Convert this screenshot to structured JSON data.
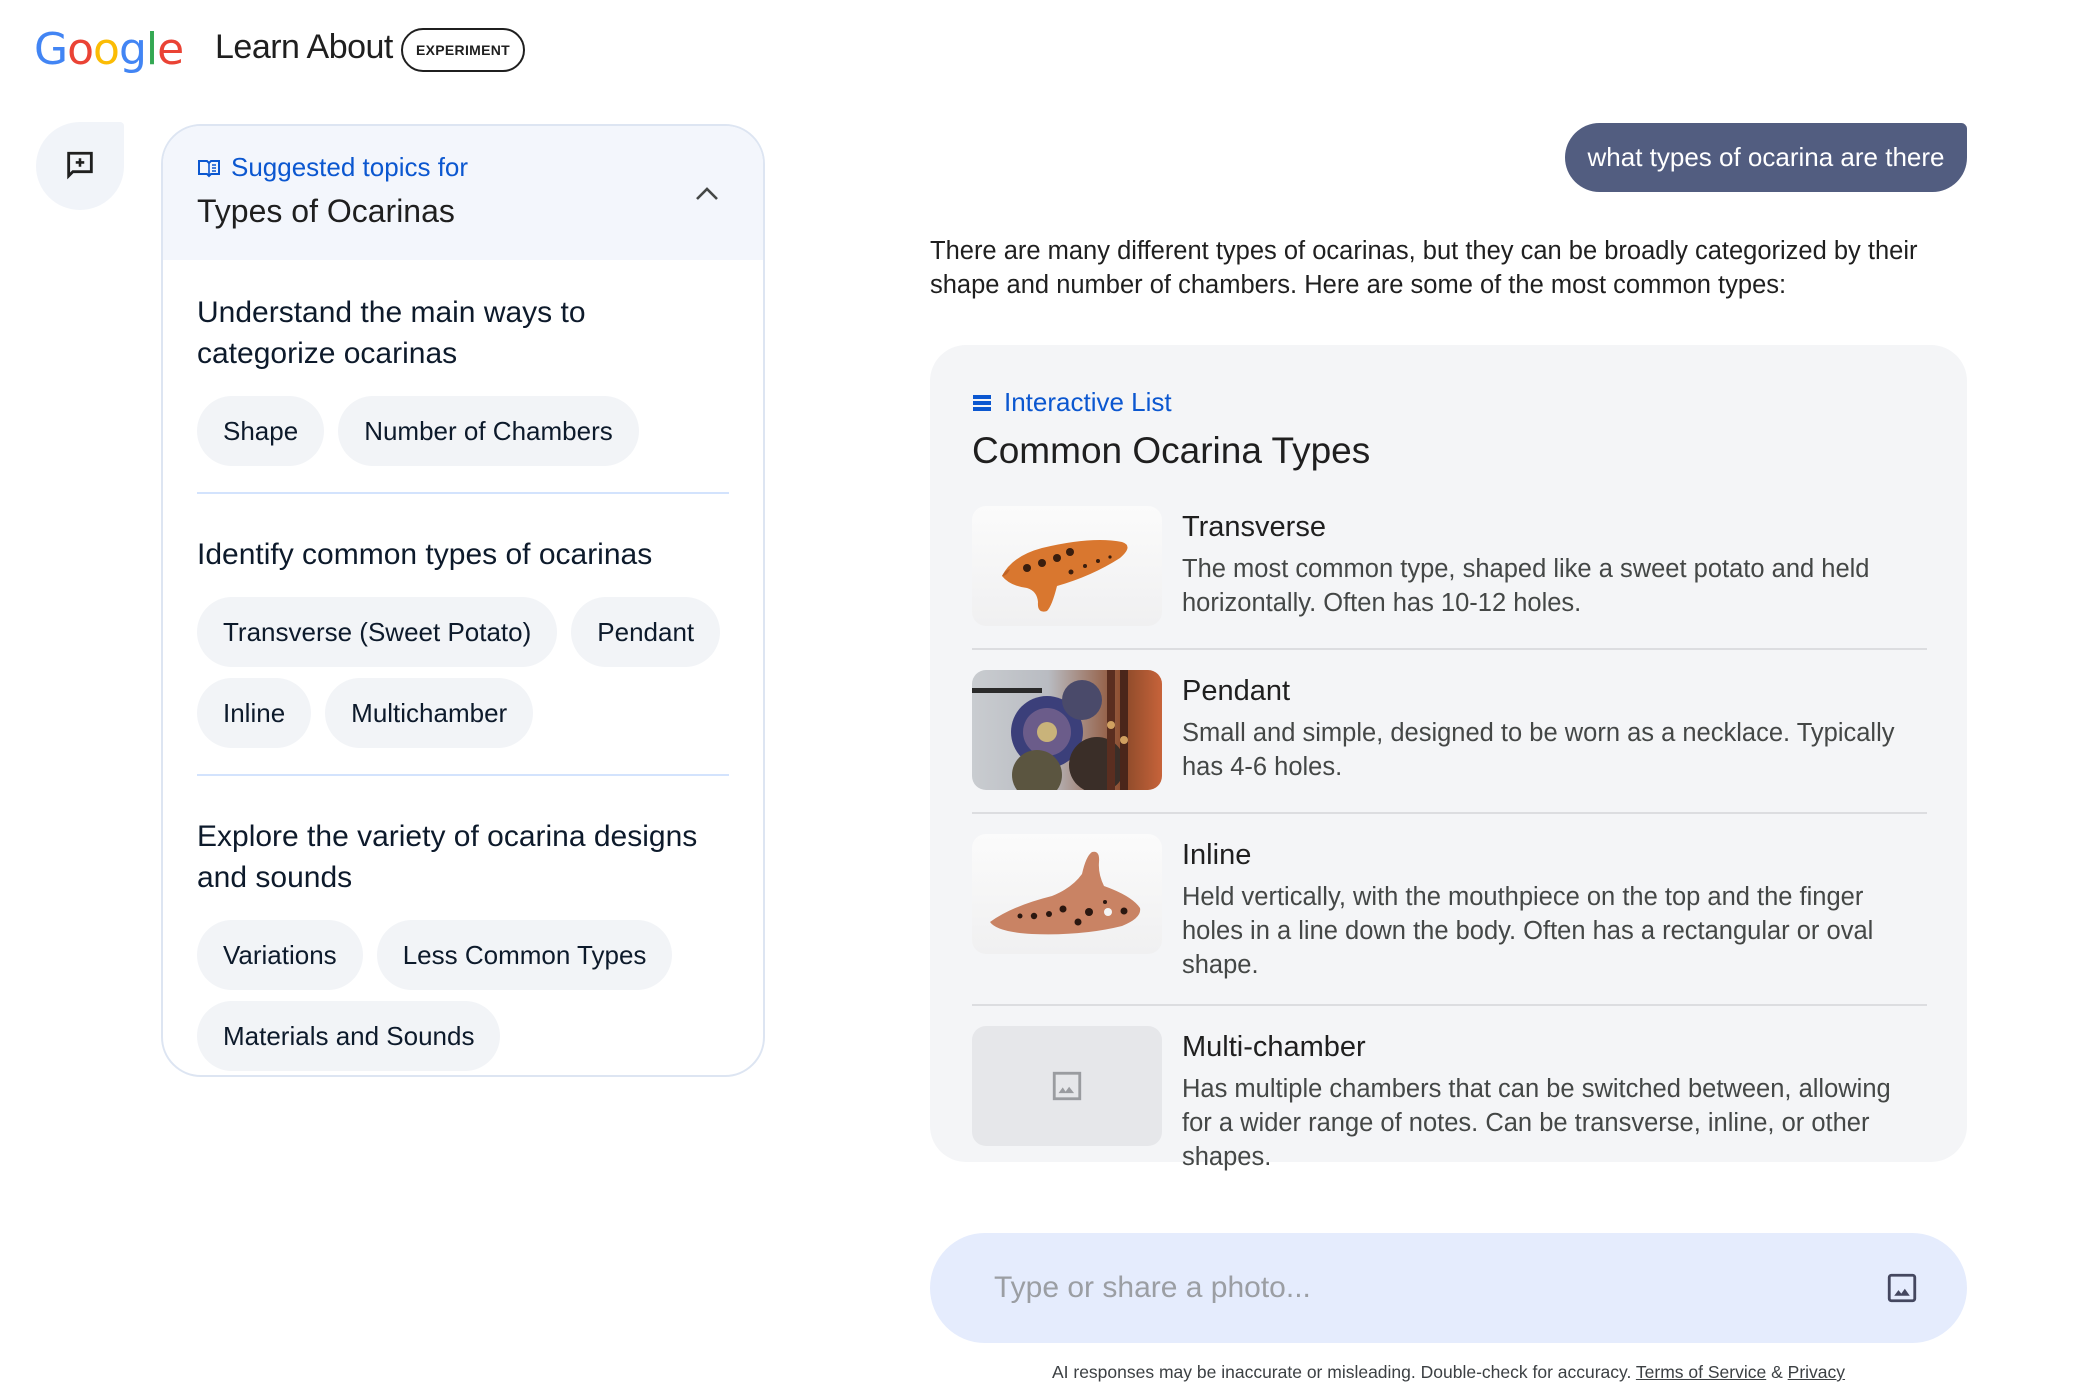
{
  "header": {
    "logo_letters": [
      {
        "char": "G",
        "color": "#4285F4"
      },
      {
        "char": "o",
        "color": "#EA4335"
      },
      {
        "char": "o",
        "color": "#FBBC05"
      },
      {
        "char": "g",
        "color": "#4285F4"
      },
      {
        "char": "l",
        "color": "#34A853"
      },
      {
        "char": "e",
        "color": "#EA4335"
      }
    ],
    "app_title": "Learn About",
    "badge": "EXPERIMENT"
  },
  "sidebar": {
    "new_chat_icon": "new-chat-icon"
  },
  "topics_panel": {
    "kicker": "Suggested topics for",
    "kicker_icon": "book-icon",
    "title": "Types of Ocarinas",
    "collapse_icon": "chevron-up-icon",
    "sections": [
      {
        "title": "Understand the main ways to categorize ocarinas",
        "chips": [
          "Shape",
          "Number of Chambers"
        ]
      },
      {
        "title": "Identify common types of ocarinas",
        "chips": [
          "Transverse (Sweet Potato)",
          "Pendant",
          "Inline",
          "Multichamber"
        ]
      },
      {
        "title": "Explore the variety of ocarina designs and sounds",
        "chips": [
          "Variations",
          "Less Common Types",
          "Materials and Sounds"
        ]
      }
    ]
  },
  "chat": {
    "user_message": "what types of ocarina are there",
    "response_intro": "There are many different types of ocarinas, but they can be broadly categorized by their shape and number of chambers. Here are some of the most common types:",
    "card": {
      "kicker": "Interactive List",
      "kicker_icon": "list-icon",
      "title": "Common Ocarina Types",
      "items": [
        {
          "title": "Transverse",
          "description": "The most common type, shaped like a sweet potato and held horizontally. Often has 10-12 holes.",
          "image": "transverse-ocarina-photo"
        },
        {
          "title": "Pendant",
          "description": "Small and simple, designed to be worn as a necklace. Typically has 4-6 holes.",
          "image": "pendant-ocarina-photo"
        },
        {
          "title": "Inline",
          "description": "Held vertically, with the mouthpiece on the top and the finger holes in a line down the body. Often has a rectangular or oval shape.",
          "image": "inline-ocarina-photo"
        },
        {
          "title": "Multi-chamber",
          "description": "Has multiple chambers that can be switched between, allowing for a wider range of notes. Can be transverse, inline, or other shapes.",
          "image": "image-placeholder-icon"
        }
      ]
    }
  },
  "input": {
    "placeholder": "Type or share a photo...",
    "value": ""
  },
  "footer": {
    "disclaimer": "AI responses may be inaccurate or misleading. Double-check for accuracy.",
    "terms_label": "Terms of Service",
    "separator": "&",
    "privacy_label": "Privacy"
  },
  "colors": {
    "accent": "#0b57d0",
    "user_bubble": "#525d80",
    "input_bg": "#e5ecfd",
    "card_bg": "#f4f5f7"
  }
}
